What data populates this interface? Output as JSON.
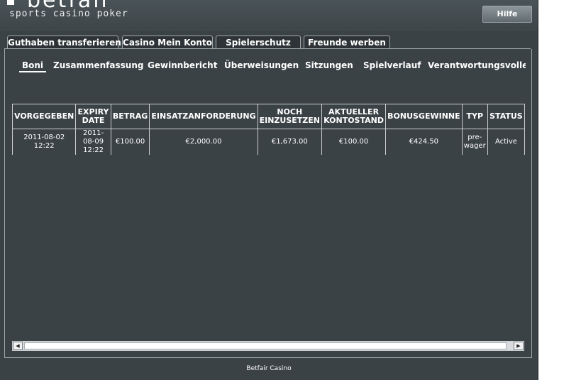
{
  "header": {
    "brand": "betfair",
    "tagline": "sports casino poker",
    "help_label": "Hilfe"
  },
  "tabs": [
    {
      "label": "Guthaben transferieren"
    },
    {
      "label": "Casino Mein Konto"
    },
    {
      "label": "Spielerschutz"
    },
    {
      "label": "Freunde werben"
    }
  ],
  "subtabs": [
    {
      "label": "Boni"
    },
    {
      "label": "Zusammenfassung"
    },
    {
      "label": "Gewinnbericht"
    },
    {
      "label": "Überweisungen"
    },
    {
      "label": "Sitzungen"
    },
    {
      "label": "Spielverlauf"
    },
    {
      "label": "Verantwortungsvolles Spiel"
    }
  ],
  "table": {
    "headers": [
      "VORGEGEBEN",
      "EXPIRY DATE",
      "BETRAG",
      "EINSATZANFORDERUNG",
      "NOCH EINZUSETZEN",
      "AKTUELLER KONTOSTAND",
      "BONUSGEWINNE",
      "TYP",
      "STATUS"
    ],
    "rows": [
      [
        "2011-08-02 12:22",
        "2011-08-09 12:22",
        "€100.00",
        "€2,000.00",
        "€1,673.00",
        "€100.00",
        "€424.50",
        "pre-wager",
        "Active"
      ]
    ]
  },
  "scrollbar": {
    "left_arrow": "◀",
    "right_arrow": "▶"
  },
  "footer": {
    "text": "Betfair Casino"
  }
}
